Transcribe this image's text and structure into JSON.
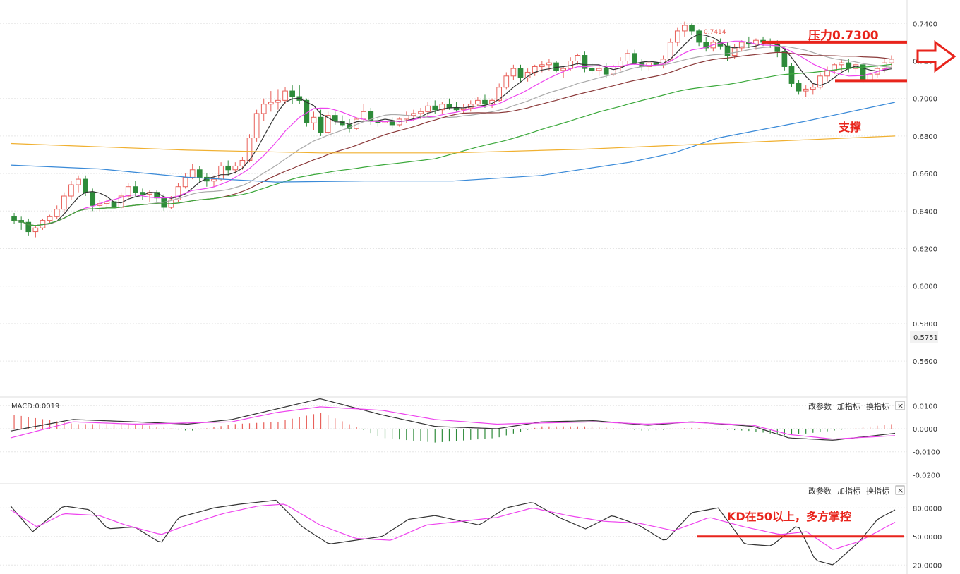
{
  "colors": {
    "up": "#e8605a",
    "down": "#2e8b3a",
    "annotation": "#e8241c",
    "grid": "#e6e6e6",
    "ma_black": "#333333",
    "ma_pink": "#ee44ee",
    "ma_gray": "#aaaaaa",
    "ma_brown": "#8b3a3a",
    "ma_green": "#3aa83a",
    "ma_blue": "#3a8ad8",
    "ma_orange": "#f0b030"
  },
  "annotations": {
    "resistance": "压力0.7300",
    "support": "支撑",
    "kd_note": "KD在50以上，多方掌控",
    "high_label": "0.7414",
    "current_price": "0.5751"
  },
  "panel_buttons": {
    "params": "改参数",
    "add": "加指标",
    "switch": "换指标",
    "close": "×"
  },
  "macd_label": "MACD:0.0019",
  "chart_data": [
    {
      "type": "candlestick",
      "ylim": [
        0.545,
        0.745
      ],
      "yticks": [
        "0.7400",
        "0.7200",
        "0.7000",
        "0.6800",
        "0.6600",
        "0.6400",
        "0.6200",
        "0.6000",
        "0.5800",
        "0.5600"
      ],
      "levels": {
        "resistance": 0.73,
        "support": 0.7095
      },
      "ohlc": [
        [
          0.637,
          0.639,
          0.633,
          0.635
        ],
        [
          0.635,
          0.637,
          0.63,
          0.634
        ],
        [
          0.634,
          0.636,
          0.627,
          0.629
        ],
        [
          0.629,
          0.632,
          0.626,
          0.631
        ],
        [
          0.631,
          0.636,
          0.63,
          0.635
        ],
        [
          0.635,
          0.638,
          0.633,
          0.637
        ],
        [
          0.637,
          0.643,
          0.636,
          0.641
        ],
        [
          0.641,
          0.65,
          0.639,
          0.648
        ],
        [
          0.648,
          0.656,
          0.646,
          0.654
        ],
        [
          0.654,
          0.659,
          0.65,
          0.657
        ],
        [
          0.657,
          0.659,
          0.648,
          0.65
        ],
        [
          0.65,
          0.652,
          0.64,
          0.643
        ],
        [
          0.643,
          0.646,
          0.64,
          0.644
        ],
        [
          0.644,
          0.647,
          0.641,
          0.645
        ],
        [
          0.645,
          0.648,
          0.641,
          0.642
        ],
        [
          0.642,
          0.65,
          0.641,
          0.648
        ],
        [
          0.648,
          0.655,
          0.647,
          0.653
        ],
        [
          0.653,
          0.656,
          0.648,
          0.65
        ],
        [
          0.65,
          0.652,
          0.646,
          0.649
        ],
        [
          0.649,
          0.651,
          0.645,
          0.65
        ],
        [
          0.65,
          0.651,
          0.644,
          0.647
        ],
        [
          0.647,
          0.649,
          0.64,
          0.642
        ],
        [
          0.642,
          0.648,
          0.641,
          0.646
        ],
        [
          0.646,
          0.655,
          0.645,
          0.653
        ],
        [
          0.653,
          0.66,
          0.652,
          0.658
        ],
        [
          0.658,
          0.665,
          0.657,
          0.662
        ],
        [
          0.662,
          0.664,
          0.655,
          0.658
        ],
        [
          0.658,
          0.66,
          0.653,
          0.656
        ],
        [
          0.656,
          0.659,
          0.653,
          0.657
        ],
        [
          0.657,
          0.666,
          0.656,
          0.664
        ],
        [
          0.664,
          0.667,
          0.659,
          0.662
        ],
        [
          0.662,
          0.666,
          0.66,
          0.664
        ],
        [
          0.664,
          0.669,
          0.662,
          0.667
        ],
        [
          0.667,
          0.681,
          0.666,
          0.679
        ],
        [
          0.679,
          0.694,
          0.677,
          0.692
        ],
        [
          0.692,
          0.7,
          0.688,
          0.697
        ],
        [
          0.697,
          0.704,
          0.693,
          0.698
        ],
        [
          0.698,
          0.705,
          0.694,
          0.699
        ],
        [
          0.699,
          0.706,
          0.697,
          0.704
        ],
        [
          0.704,
          0.707,
          0.697,
          0.701
        ],
        [
          0.701,
          0.707,
          0.697,
          0.699
        ],
        [
          0.699,
          0.7,
          0.685,
          0.687
        ],
        [
          0.687,
          0.693,
          0.683,
          0.69
        ],
        [
          0.69,
          0.694,
          0.68,
          0.682
        ],
        [
          0.682,
          0.693,
          0.681,
          0.691
        ],
        [
          0.691,
          0.693,
          0.686,
          0.688
        ],
        [
          0.688,
          0.691,
          0.685,
          0.686
        ],
        [
          0.686,
          0.689,
          0.682,
          0.684
        ],
        [
          0.684,
          0.69,
          0.683,
          0.689
        ],
        [
          0.689,
          0.697,
          0.688,
          0.693
        ],
        [
          0.693,
          0.695,
          0.686,
          0.688
        ],
        [
          0.688,
          0.69,
          0.685,
          0.687
        ],
        [
          0.687,
          0.69,
          0.684,
          0.688
        ],
        [
          0.688,
          0.69,
          0.684,
          0.686
        ],
        [
          0.686,
          0.69,
          0.685,
          0.689
        ],
        [
          0.689,
          0.693,
          0.687,
          0.691
        ],
        [
          0.691,
          0.694,
          0.688,
          0.692
        ],
        [
          0.692,
          0.695,
          0.689,
          0.693
        ],
        [
          0.693,
          0.698,
          0.691,
          0.696
        ],
        [
          0.696,
          0.699,
          0.692,
          0.694
        ],
        [
          0.694,
          0.698,
          0.692,
          0.697
        ],
        [
          0.697,
          0.7,
          0.694,
          0.695
        ],
        [
          0.695,
          0.698,
          0.693,
          0.694
        ],
        [
          0.694,
          0.697,
          0.692,
          0.695
        ],
        [
          0.695,
          0.699,
          0.693,
          0.697
        ],
        [
          0.697,
          0.701,
          0.696,
          0.699
        ],
        [
          0.699,
          0.702,
          0.695,
          0.697
        ],
        [
          0.697,
          0.7,
          0.695,
          0.699
        ],
        [
          0.699,
          0.708,
          0.698,
          0.706
        ],
        [
          0.706,
          0.714,
          0.705,
          0.712
        ],
        [
          0.712,
          0.718,
          0.71,
          0.716
        ],
        [
          0.716,
          0.718,
          0.709,
          0.711
        ],
        [
          0.711,
          0.716,
          0.709,
          0.714
        ],
        [
          0.714,
          0.718,
          0.712,
          0.717
        ],
        [
          0.717,
          0.72,
          0.714,
          0.718
        ],
        [
          0.718,
          0.721,
          0.715,
          0.719
        ],
        [
          0.719,
          0.72,
          0.714,
          0.715
        ],
        [
          0.715,
          0.717,
          0.711,
          0.716
        ],
        [
          0.716,
          0.722,
          0.715,
          0.72
        ],
        [
          0.72,
          0.724,
          0.718,
          0.723
        ],
        [
          0.723,
          0.725,
          0.714,
          0.716
        ],
        [
          0.716,
          0.719,
          0.713,
          0.715
        ],
        [
          0.715,
          0.718,
          0.712,
          0.716
        ],
        [
          0.716,
          0.719,
          0.711,
          0.713
        ],
        [
          0.713,
          0.718,
          0.712,
          0.717
        ],
        [
          0.717,
          0.722,
          0.715,
          0.72
        ],
        [
          0.72,
          0.726,
          0.718,
          0.724
        ],
        [
          0.724,
          0.726,
          0.718,
          0.719
        ],
        [
          0.719,
          0.721,
          0.715,
          0.717
        ],
        [
          0.717,
          0.72,
          0.715,
          0.719
        ],
        [
          0.719,
          0.721,
          0.716,
          0.718
        ],
        [
          0.718,
          0.723,
          0.716,
          0.721
        ],
        [
          0.721,
          0.732,
          0.72,
          0.73
        ],
        [
          0.73,
          0.738,
          0.728,
          0.736
        ],
        [
          0.736,
          0.741,
          0.733,
          0.739
        ],
        [
          0.739,
          0.74,
          0.734,
          0.736
        ],
        [
          0.736,
          0.737,
          0.728,
          0.73
        ],
        [
          0.73,
          0.733,
          0.725,
          0.727
        ],
        [
          0.727,
          0.731,
          0.725,
          0.73
        ],
        [
          0.73,
          0.732,
          0.726,
          0.728
        ],
        [
          0.728,
          0.73,
          0.72,
          0.723
        ],
        [
          0.723,
          0.729,
          0.721,
          0.727
        ],
        [
          0.727,
          0.731,
          0.725,
          0.73
        ],
        [
          0.73,
          0.733,
          0.727,
          0.729
        ],
        [
          0.729,
          0.732,
          0.726,
          0.731
        ],
        [
          0.731,
          0.733,
          0.728,
          0.73
        ],
        [
          0.73,
          0.732,
          0.727,
          0.729
        ],
        [
          0.729,
          0.731,
          0.722,
          0.725
        ],
        [
          0.725,
          0.727,
          0.715,
          0.717
        ],
        [
          0.717,
          0.719,
          0.706,
          0.708
        ],
        [
          0.708,
          0.71,
          0.702,
          0.704
        ],
        [
          0.704,
          0.707,
          0.701,
          0.705
        ],
        [
          0.705,
          0.708,
          0.702,
          0.706
        ],
        [
          0.706,
          0.714,
          0.705,
          0.712
        ],
        [
          0.712,
          0.717,
          0.709,
          0.715
        ],
        [
          0.715,
          0.719,
          0.713,
          0.718
        ],
        [
          0.718,
          0.721,
          0.715,
          0.719
        ],
        [
          0.719,
          0.721,
          0.714,
          0.716
        ],
        [
          0.716,
          0.72,
          0.714,
          0.718
        ],
        [
          0.718,
          0.72,
          0.708,
          0.71
        ],
        [
          0.71,
          0.714,
          0.709,
          0.713
        ],
        [
          0.713,
          0.717,
          0.711,
          0.716
        ],
        [
          0.716,
          0.721,
          0.714,
          0.719
        ],
        [
          0.719,
          0.723,
          0.717,
          0.721
        ]
      ],
      "ma": [
        {
          "color": "ma_black",
          "period": 5
        },
        {
          "color": "ma_pink",
          "period": 10
        },
        {
          "color": "ma_gray",
          "period": 20
        },
        {
          "color": "ma_brown",
          "period": 30
        },
        {
          "color": "ma_green",
          "period": 60
        }
      ],
      "long_ma_blue": [
        [
          0,
          0.6645
        ],
        [
          0.1,
          0.6625
        ],
        [
          0.2,
          0.658
        ],
        [
          0.3,
          0.6555
        ],
        [
          0.4,
          0.656
        ],
        [
          0.5,
          0.656
        ],
        [
          0.6,
          0.659
        ],
        [
          0.7,
          0.666
        ],
        [
          0.75,
          0.671
        ],
        [
          0.8,
          0.679
        ],
        [
          0.9,
          0.688
        ],
        [
          1.0,
          0.698
        ]
      ],
      "long_ma_orange": [
        [
          0,
          0.676
        ],
        [
          0.2,
          0.6725
        ],
        [
          0.35,
          0.671
        ],
        [
          0.5,
          0.671
        ],
        [
          0.65,
          0.673
        ],
        [
          0.8,
          0.676
        ],
        [
          1.0,
          0.68
        ]
      ]
    },
    {
      "type": "macd",
      "ylim": [
        -0.022,
        0.011
      ],
      "yticks": [
        "0.0100",
        "0.0000",
        "-0.0100",
        "-0.0200"
      ],
      "dif": [
        [
          0,
          -0.001
        ],
        [
          0.07,
          0.004
        ],
        [
          0.14,
          0.003
        ],
        [
          0.2,
          0.002
        ],
        [
          0.25,
          0.004
        ],
        [
          0.3,
          0.0085
        ],
        [
          0.35,
          0.013
        ],
        [
          0.42,
          0.006
        ],
        [
          0.48,
          0.001
        ],
        [
          0.55,
          0.0
        ],
        [
          0.6,
          0.003
        ],
        [
          0.66,
          0.0035
        ],
        [
          0.72,
          0.0015
        ],
        [
          0.77,
          0.003
        ],
        [
          0.84,
          0.001
        ],
        [
          0.88,
          -0.004
        ],
        [
          0.93,
          -0.005
        ],
        [
          1.0,
          -0.002
        ]
      ],
      "dea": [
        [
          0,
          -0.004
        ],
        [
          0.07,
          0.003
        ],
        [
          0.14,
          0.002
        ],
        [
          0.2,
          0.0025
        ],
        [
          0.25,
          0.003
        ],
        [
          0.3,
          0.007
        ],
        [
          0.35,
          0.0095
        ],
        [
          0.42,
          0.008
        ],
        [
          0.48,
          0.004
        ],
        [
          0.55,
          0.002
        ],
        [
          0.6,
          0.0025
        ],
        [
          0.66,
          0.003
        ],
        [
          0.72,
          0.002
        ],
        [
          0.77,
          0.0028
        ],
        [
          0.84,
          0.0015
        ],
        [
          0.88,
          -0.0025
        ],
        [
          0.93,
          -0.0045
        ],
        [
          1.0,
          -0.003
        ]
      ]
    },
    {
      "type": "kd",
      "ylim": [
        15,
        95
      ],
      "yticks": [
        "80.0000",
        "50.0000",
        "20.0000"
      ],
      "level": 50,
      "k": [
        [
          0,
          82
        ],
        [
          0.025,
          55
        ],
        [
          0.06,
          82
        ],
        [
          0.09,
          78
        ],
        [
          0.11,
          58
        ],
        [
          0.14,
          60
        ],
        [
          0.17,
          43
        ],
        [
          0.19,
          70
        ],
        [
          0.23,
          80
        ],
        [
          0.26,
          84
        ],
        [
          0.3,
          88
        ],
        [
          0.33,
          60
        ],
        [
          0.36,
          42
        ],
        [
          0.39,
          46
        ],
        [
          0.42,
          50
        ],
        [
          0.45,
          68
        ],
        [
          0.48,
          72
        ],
        [
          0.5,
          68
        ],
        [
          0.53,
          62
        ],
        [
          0.56,
          80
        ],
        [
          0.59,
          86
        ],
        [
          0.62,
          70
        ],
        [
          0.65,
          58
        ],
        [
          0.68,
          72
        ],
        [
          0.71,
          62
        ],
        [
          0.74,
          45
        ],
        [
          0.77,
          75
        ],
        [
          0.8,
          80
        ],
        [
          0.83,
          42
        ],
        [
          0.86,
          40
        ],
        [
          0.89,
          62
        ],
        [
          0.91,
          25
        ],
        [
          0.93,
          20
        ],
        [
          0.96,
          45
        ],
        [
          0.98,
          68
        ],
        [
          1.0,
          78
        ]
      ],
      "d": [
        [
          0,
          78
        ],
        [
          0.03,
          60
        ],
        [
          0.06,
          74
        ],
        [
          0.1,
          72
        ],
        [
          0.13,
          62
        ],
        [
          0.17,
          52
        ],
        [
          0.2,
          62
        ],
        [
          0.24,
          74
        ],
        [
          0.28,
          82
        ],
        [
          0.31,
          84
        ],
        [
          0.35,
          62
        ],
        [
          0.39,
          48
        ],
        [
          0.43,
          46
        ],
        [
          0.47,
          62
        ],
        [
          0.51,
          66
        ],
        [
          0.55,
          70
        ],
        [
          0.59,
          80
        ],
        [
          0.63,
          72
        ],
        [
          0.67,
          66
        ],
        [
          0.71,
          64
        ],
        [
          0.75,
          56
        ],
        [
          0.79,
          70
        ],
        [
          0.83,
          60
        ],
        [
          0.87,
          52
        ],
        [
          0.9,
          55
        ],
        [
          0.93,
          36
        ],
        [
          0.96,
          45
        ],
        [
          1.0,
          65
        ]
      ]
    }
  ]
}
